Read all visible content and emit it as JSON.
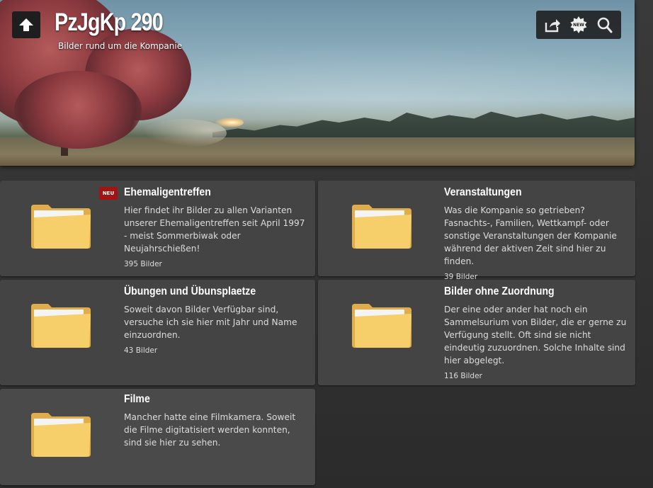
{
  "header": {
    "title": "PzJgKp 290",
    "subtitle": "Bilder rund um die Kompanie",
    "home_icon": "arrow-up-icon",
    "tools": [
      {
        "icon": "share-icon"
      },
      {
        "icon": "new-badge-icon",
        "text": "NEW"
      },
      {
        "icon": "search-icon"
      }
    ]
  },
  "albums": [
    {
      "title": "Ehemaligentreffen",
      "badge": "NEU",
      "description": "Hier findet ihr Bilder zu allen Varianten unserer Ehemaligentreffen seit April 1997 - meist Sommerbiwak oder Neujahrschießen!",
      "count": "395 Bilder"
    },
    {
      "title": "Veranstaltungen",
      "description": "Was die Kompanie so getrieben? Fasnachts-, Familien, Wettkampf- oder sonstige Veranstaltungen der Kompanie während der aktiven Zeit sind hier zu finden.",
      "count": "39 Bilder"
    },
    {
      "title": "Übungen und Übunsplaetze",
      "description": "Soweit davon Bilder Verfügbar sind, versuche ich sie hier mit Jahr und Name einzuordnen.",
      "count": "43 Bilder"
    },
    {
      "title": "Bilder ohne Zuordnung",
      "description": "Der eine oder ander hat noch ein Sammelsurium von Bilder, die er gerne zu Verfügung stellt. Oft sind sie nicht eindeutig zuzuordnen. Solche Inhalte sind hier abgelegt.",
      "count": "116 Bilder"
    },
    {
      "title": "Filme",
      "description": "Mancher hatte eine Filmkamera. Soweit die Filme digitatisiert werden konnten, sind sie hier zu sehen.",
      "count": ""
    }
  ],
  "colors": {
    "card_bg": "#444444",
    "badge_red": "#a21414",
    "folder_yellow": "#f7cf6a"
  }
}
